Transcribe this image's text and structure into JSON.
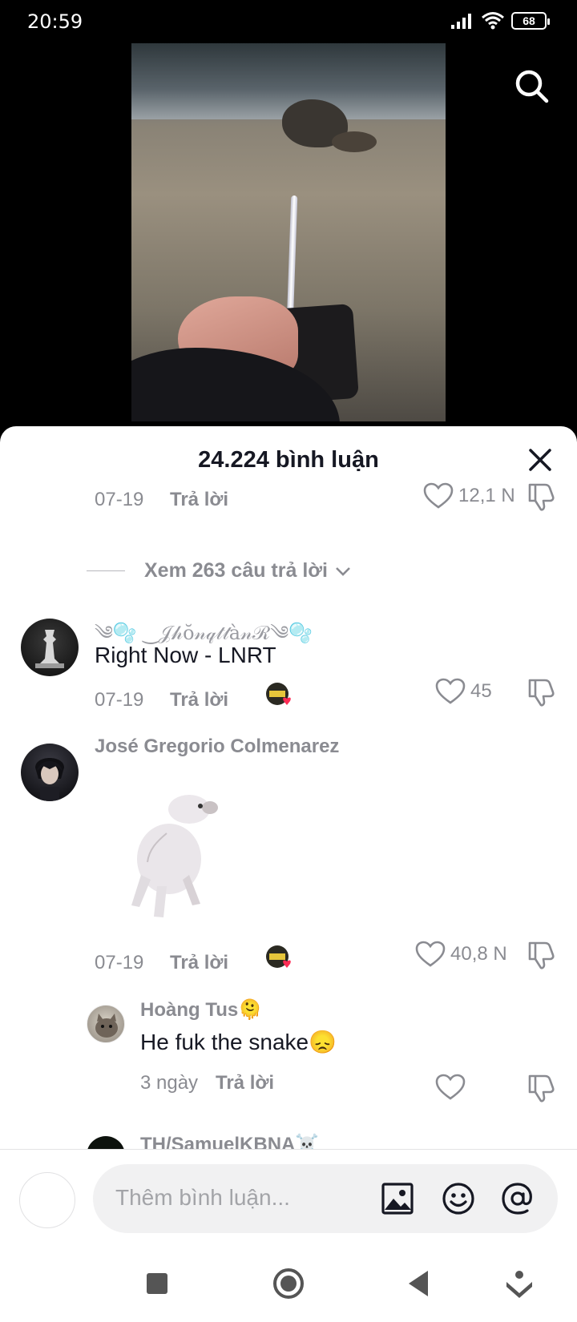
{
  "status_bar": {
    "time": "20:59",
    "battery": "68"
  },
  "video": {
    "icons": [
      "search-icon"
    ]
  },
  "comments_panel": {
    "title": "24.224 bình luận",
    "top_comment_meta": {
      "date": "07-19",
      "reply_label": "Trả lời",
      "likes": "12,1 N"
    },
    "view_replies_label": "Xem 263 câu trả lời",
    "comments": [
      {
        "username": "༄🫧 ‿𝒥𝒽ŏ𝓃𝓆𝓉𝓉à𝓃ℛ༄🫧",
        "text": "Right Now - LNRT",
        "date": "07-19",
        "reply_label": "Trả lời",
        "likes": "45"
      },
      {
        "username": "José Gregorio Colmenarez",
        "text": "",
        "date": "07-19",
        "reply_label": "Trả lời",
        "likes": "40,8 N"
      },
      {
        "username": "Hoàng Tus🫠",
        "text": "He fuk the snake😞",
        "date": "3 ngày",
        "reply_label": "Trả lời",
        "likes": ""
      },
      {
        "username": "TH/SamuelKBNA☠️"
      }
    ]
  },
  "input": {
    "placeholder": "Thêm bình luận..."
  },
  "colors": {
    "accent_like": "#fe2c55",
    "muted": "#8a8b91",
    "text": "#161823"
  }
}
